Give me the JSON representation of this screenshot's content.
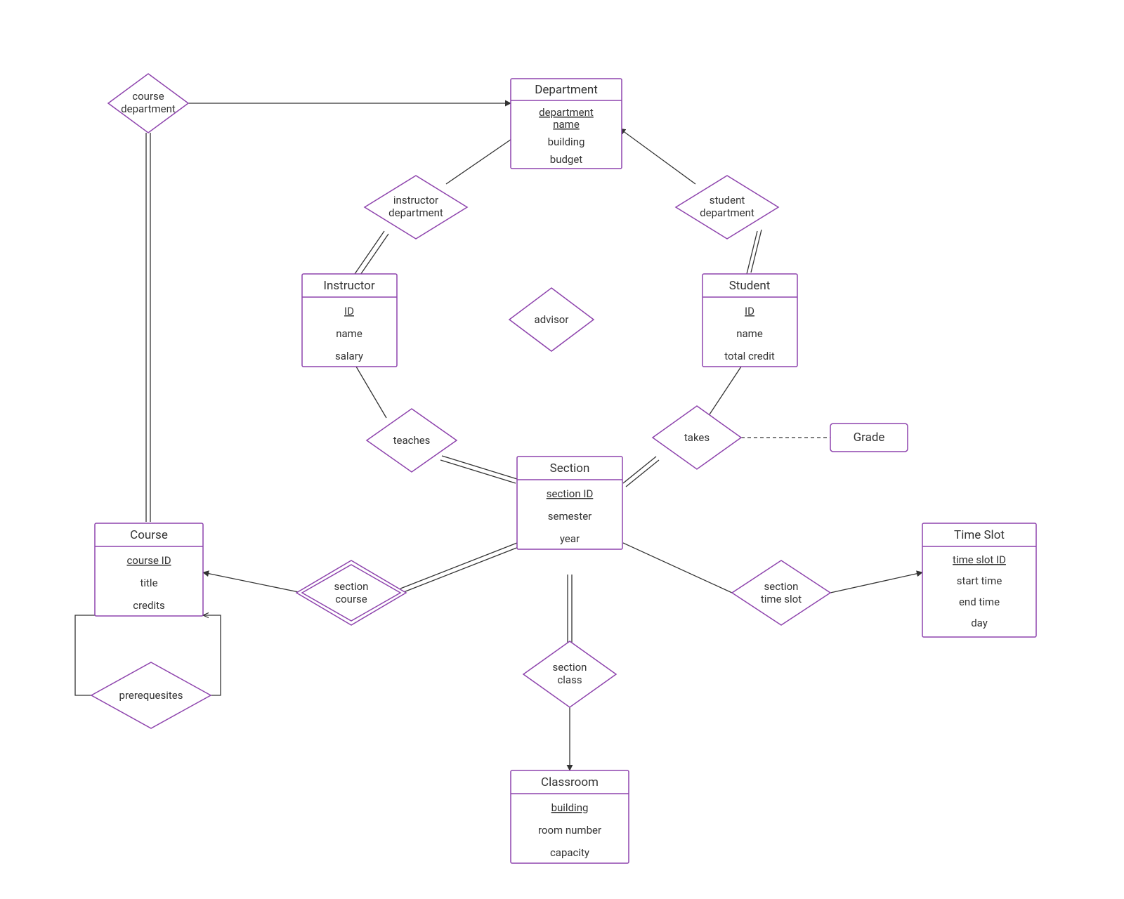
{
  "colors": {
    "stroke": "#8e44ad",
    "edge": "#333333",
    "bg": "#ffffff"
  },
  "entities": {
    "department": {
      "title": "Department",
      "attrs": [
        "department name",
        "building",
        "budget"
      ],
      "pkey": [
        0
      ]
    },
    "instructor": {
      "title": "Instructor",
      "attrs": [
        "ID",
        "name",
        "salary"
      ],
      "pkey": [
        0
      ]
    },
    "student": {
      "title": "Student",
      "attrs": [
        "ID",
        "name",
        "total credit"
      ],
      "pkey": [
        0
      ]
    },
    "section": {
      "title": "Section",
      "attrs": [
        "section ID",
        "semester",
        "year"
      ],
      "pkey": [
        0
      ]
    },
    "course": {
      "title": "Course",
      "attrs": [
        "course ID",
        "title",
        "credits"
      ],
      "pkey": [
        0
      ]
    },
    "timeslot": {
      "title": "Time Slot",
      "attrs": [
        "time slot ID",
        "start time",
        "end time",
        "day"
      ],
      "pkey": [
        0
      ]
    },
    "classroom": {
      "title": "Classroom",
      "attrs": [
        "building",
        "room number",
        "capacity"
      ],
      "pkey": [
        0
      ]
    },
    "grade": {
      "title": "Grade",
      "attrs": [],
      "pkey": []
    }
  },
  "relationships": {
    "course_department": {
      "label1": "course",
      "label2": "department"
    },
    "instructor_department": {
      "label1": "instructor",
      "label2": "department"
    },
    "student_department": {
      "label1": "student",
      "label2": "department"
    },
    "advisor": {
      "label1": "advisor",
      "label2": ""
    },
    "teaches": {
      "label1": "teaches",
      "label2": ""
    },
    "takes": {
      "label1": "takes",
      "label2": ""
    },
    "section_course": {
      "label1": "section",
      "label2": "course",
      "weak": true
    },
    "section_timeslot": {
      "label1": "section",
      "label2": "time slot"
    },
    "section_class": {
      "label1": "section",
      "label2": "class"
    },
    "prerequisites": {
      "label1": "prerequesites",
      "label2": ""
    }
  }
}
